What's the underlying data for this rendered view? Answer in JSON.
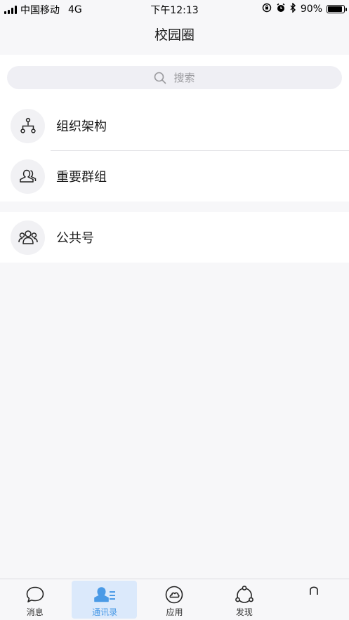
{
  "status_bar": {
    "carrier": "中国移动",
    "network": "4G",
    "time": "下午12:13",
    "battery": "90%",
    "battery_level": 0.9
  },
  "header": {
    "title": "校园圈"
  },
  "search": {
    "placeholder": "搜索"
  },
  "groups": [
    {
      "items": [
        {
          "label": "组织架构",
          "icon": "org-chart-icon"
        },
        {
          "label": "重要群组",
          "icon": "group-people-icon"
        }
      ]
    },
    {
      "items": [
        {
          "label": "公共号",
          "icon": "public-account-icon"
        }
      ]
    }
  ],
  "tabbar": {
    "active_color": "#4a9ae6",
    "tabs": [
      {
        "label": "消息",
        "icon": "chat-bubble-icon",
        "active": false
      },
      {
        "label": "通讯录",
        "icon": "contacts-icon",
        "active": true
      },
      {
        "label": "应用",
        "icon": "apps-cloud-icon",
        "active": false
      },
      {
        "label": "发现",
        "icon": "discover-icon",
        "active": false
      },
      {
        "label": "",
        "icon": "me-icon",
        "active": false
      }
    ]
  }
}
